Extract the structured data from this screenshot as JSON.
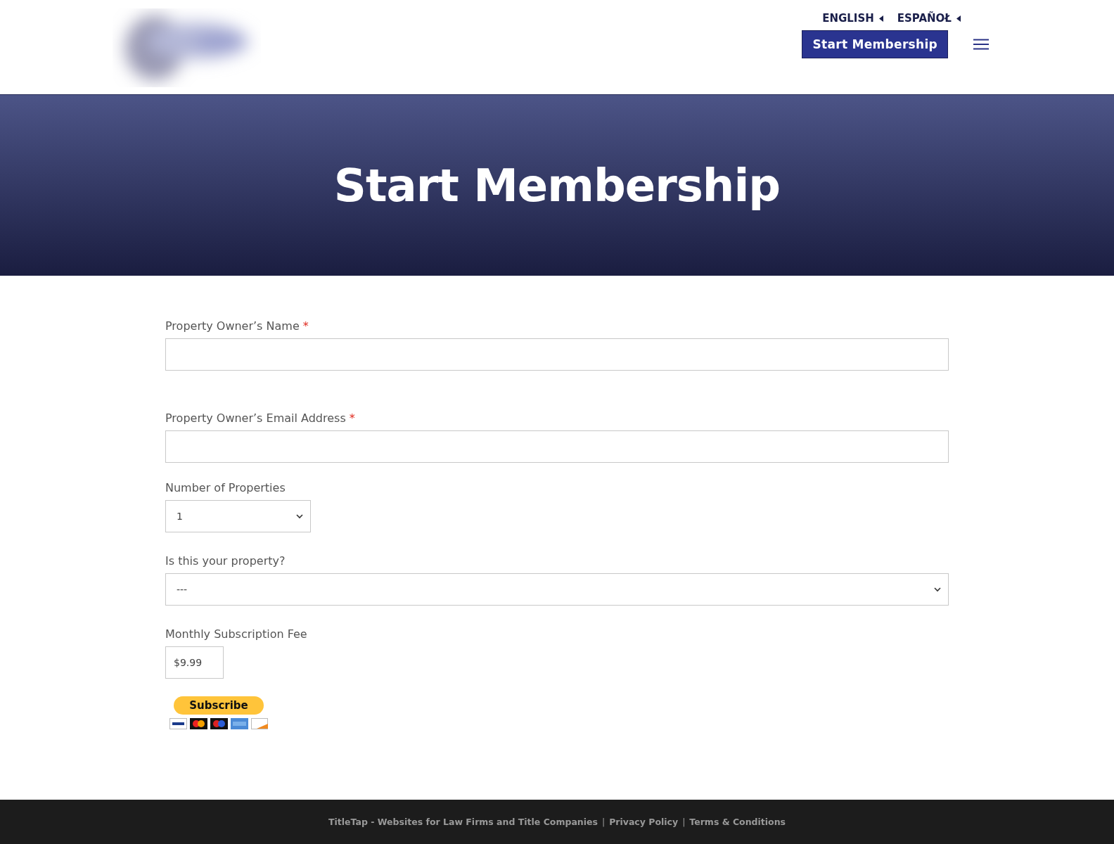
{
  "header": {
    "languages": [
      {
        "label": "ENGLISH"
      },
      {
        "label": "ESPAÑOŁ"
      }
    ],
    "cta": "Start Membership"
  },
  "hero": {
    "title": "Start Membership"
  },
  "form": {
    "fields": [
      {
        "kind": "text",
        "label": "Property Owner’s Name",
        "marker": "*"
      },
      {
        "kind": "text",
        "label": "Property Owner’s Email Address",
        "marker": "*"
      },
      {
        "kind": "dropdown",
        "label": "Number of Properties",
        "value": "1"
      },
      {
        "kind": "select",
        "label": "Is this your property?",
        "value": "---"
      },
      {
        "kind": "price",
        "label": "Monthly Subscription Fee",
        "value": "$9.99"
      }
    ],
    "subscribe": "Subscribe"
  },
  "footer": {
    "items": [
      {
        "kind": "link",
        "text": "TitleTap - Websites for Law Firms and Title Companies"
      },
      {
        "kind": "separator",
        "text": "|"
      },
      {
        "kind": "link",
        "text": "Privacy Policy"
      },
      {
        "kind": "separator",
        "text": "|"
      },
      {
        "kind": "link",
        "text": "Terms & Conditions"
      }
    ]
  }
}
